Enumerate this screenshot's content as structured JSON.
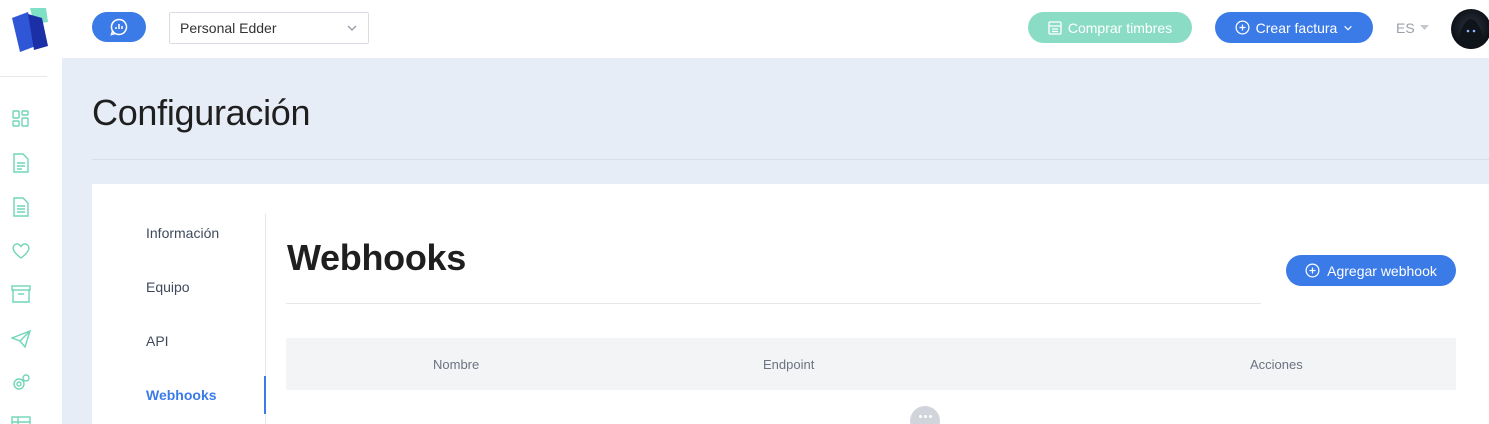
{
  "topbar": {
    "account_select_value": "Personal Edder",
    "buy_stamps_label": "Comprar timbres",
    "create_invoice_label": "Crear factura",
    "language": "ES"
  },
  "page": {
    "title": "Configuración"
  },
  "settings_nav": {
    "items": [
      {
        "label": "Información"
      },
      {
        "label": "Equipo"
      },
      {
        "label": "API"
      },
      {
        "label": "Webhooks"
      }
    ],
    "active": "Webhooks"
  },
  "webhooks": {
    "title": "Webhooks",
    "add_button_label": "Agregar webhook",
    "columns": [
      "Nombre",
      "Endpoint",
      "Acciones"
    ]
  },
  "sidebar": {
    "icons": [
      "dashboard-icon",
      "document-icon",
      "invoice-icon",
      "heart-icon",
      "archive-icon",
      "send-icon",
      "settings-icon",
      "table-icon"
    ]
  },
  "colors": {
    "primary": "#3b7be8",
    "accent_mint": "#8bdcc4",
    "background": "#e6edf7"
  }
}
